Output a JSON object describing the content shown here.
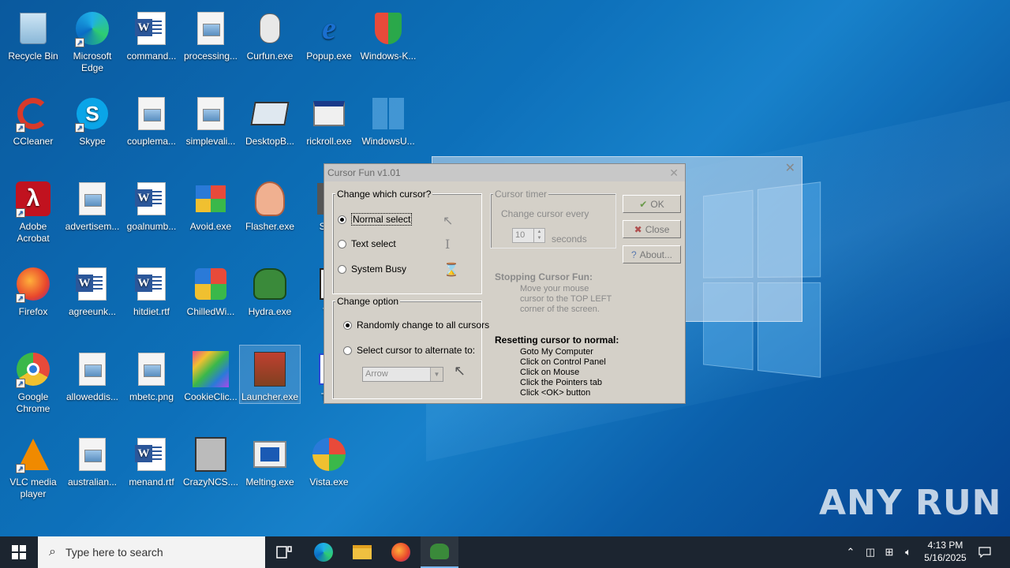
{
  "desktop": {
    "icons": [
      {
        "label": "Recycle Bin"
      },
      {
        "label": "Microsoft Edge"
      },
      {
        "label": "command..."
      },
      {
        "label": "processing..."
      },
      {
        "label": "Curfun.exe"
      },
      {
        "label": "Popup.exe"
      },
      {
        "label": "Windows-K..."
      },
      {
        "label": "CCleaner"
      },
      {
        "label": "Skype"
      },
      {
        "label": "couplema..."
      },
      {
        "label": "simplevali..."
      },
      {
        "label": "DesktopB..."
      },
      {
        "label": "rickroll.exe"
      },
      {
        "label": "WindowsU..."
      },
      {
        "label": "Adobe Acrobat"
      },
      {
        "label": "advertisem..."
      },
      {
        "label": "goalnumb..."
      },
      {
        "label": "Avoid.exe"
      },
      {
        "label": "Flasher.exe"
      },
      {
        "label": "Scre"
      },
      {
        "label": "Firefox"
      },
      {
        "label": "agreeunk..."
      },
      {
        "label": "hitdiet.rtf"
      },
      {
        "label": "ChilledWi..."
      },
      {
        "label": "Hydra.exe"
      },
      {
        "label": "Tin"
      },
      {
        "label": "Google Chrome"
      },
      {
        "label": "alloweddis..."
      },
      {
        "label": "mbetc.png"
      },
      {
        "label": "CookieClic..."
      },
      {
        "label": "Launcher.exe"
      },
      {
        "label": "Trol"
      },
      {
        "label": "VLC media player"
      },
      {
        "label": "australian..."
      },
      {
        "label": "menand.rtf"
      },
      {
        "label": "CrazyNCS...."
      },
      {
        "label": "Melting.exe"
      },
      {
        "label": "Vista.exe"
      }
    ]
  },
  "dialog": {
    "title": "Cursor Fun v1.01",
    "which_cursor": {
      "legend": "Change which cursor?",
      "options": [
        "Normal select",
        "Text select",
        "System Busy"
      ],
      "selected": "Normal select"
    },
    "change_option": {
      "legend": "Change option",
      "random_label": "Randomly change to all cursors",
      "select_label": "Select cursor to alternate to:",
      "dropdown_value": "Arrow"
    },
    "timer": {
      "legend": "Cursor timer",
      "change_every": "Change cursor every",
      "value": "10",
      "unit": "seconds"
    },
    "buttons": {
      "ok": "OK",
      "close": "Close",
      "about": "About..."
    },
    "stopping": {
      "title": "Stopping Cursor Fun:",
      "lines": [
        "Move your mouse",
        "cursor to the TOP LEFT",
        "corner of the screen."
      ]
    },
    "resetting": {
      "title": "Resetting cursor to normal:",
      "lines": [
        "Goto My Computer",
        "Click on Control Panel",
        "Click on Mouse",
        "Click the Pointers tab",
        "Click <OK> button"
      ]
    }
  },
  "taskbar": {
    "search_placeholder": "Type here to search",
    "time": "4:13 PM",
    "date": "5/16/2025"
  },
  "watermark": "ANY RUN"
}
